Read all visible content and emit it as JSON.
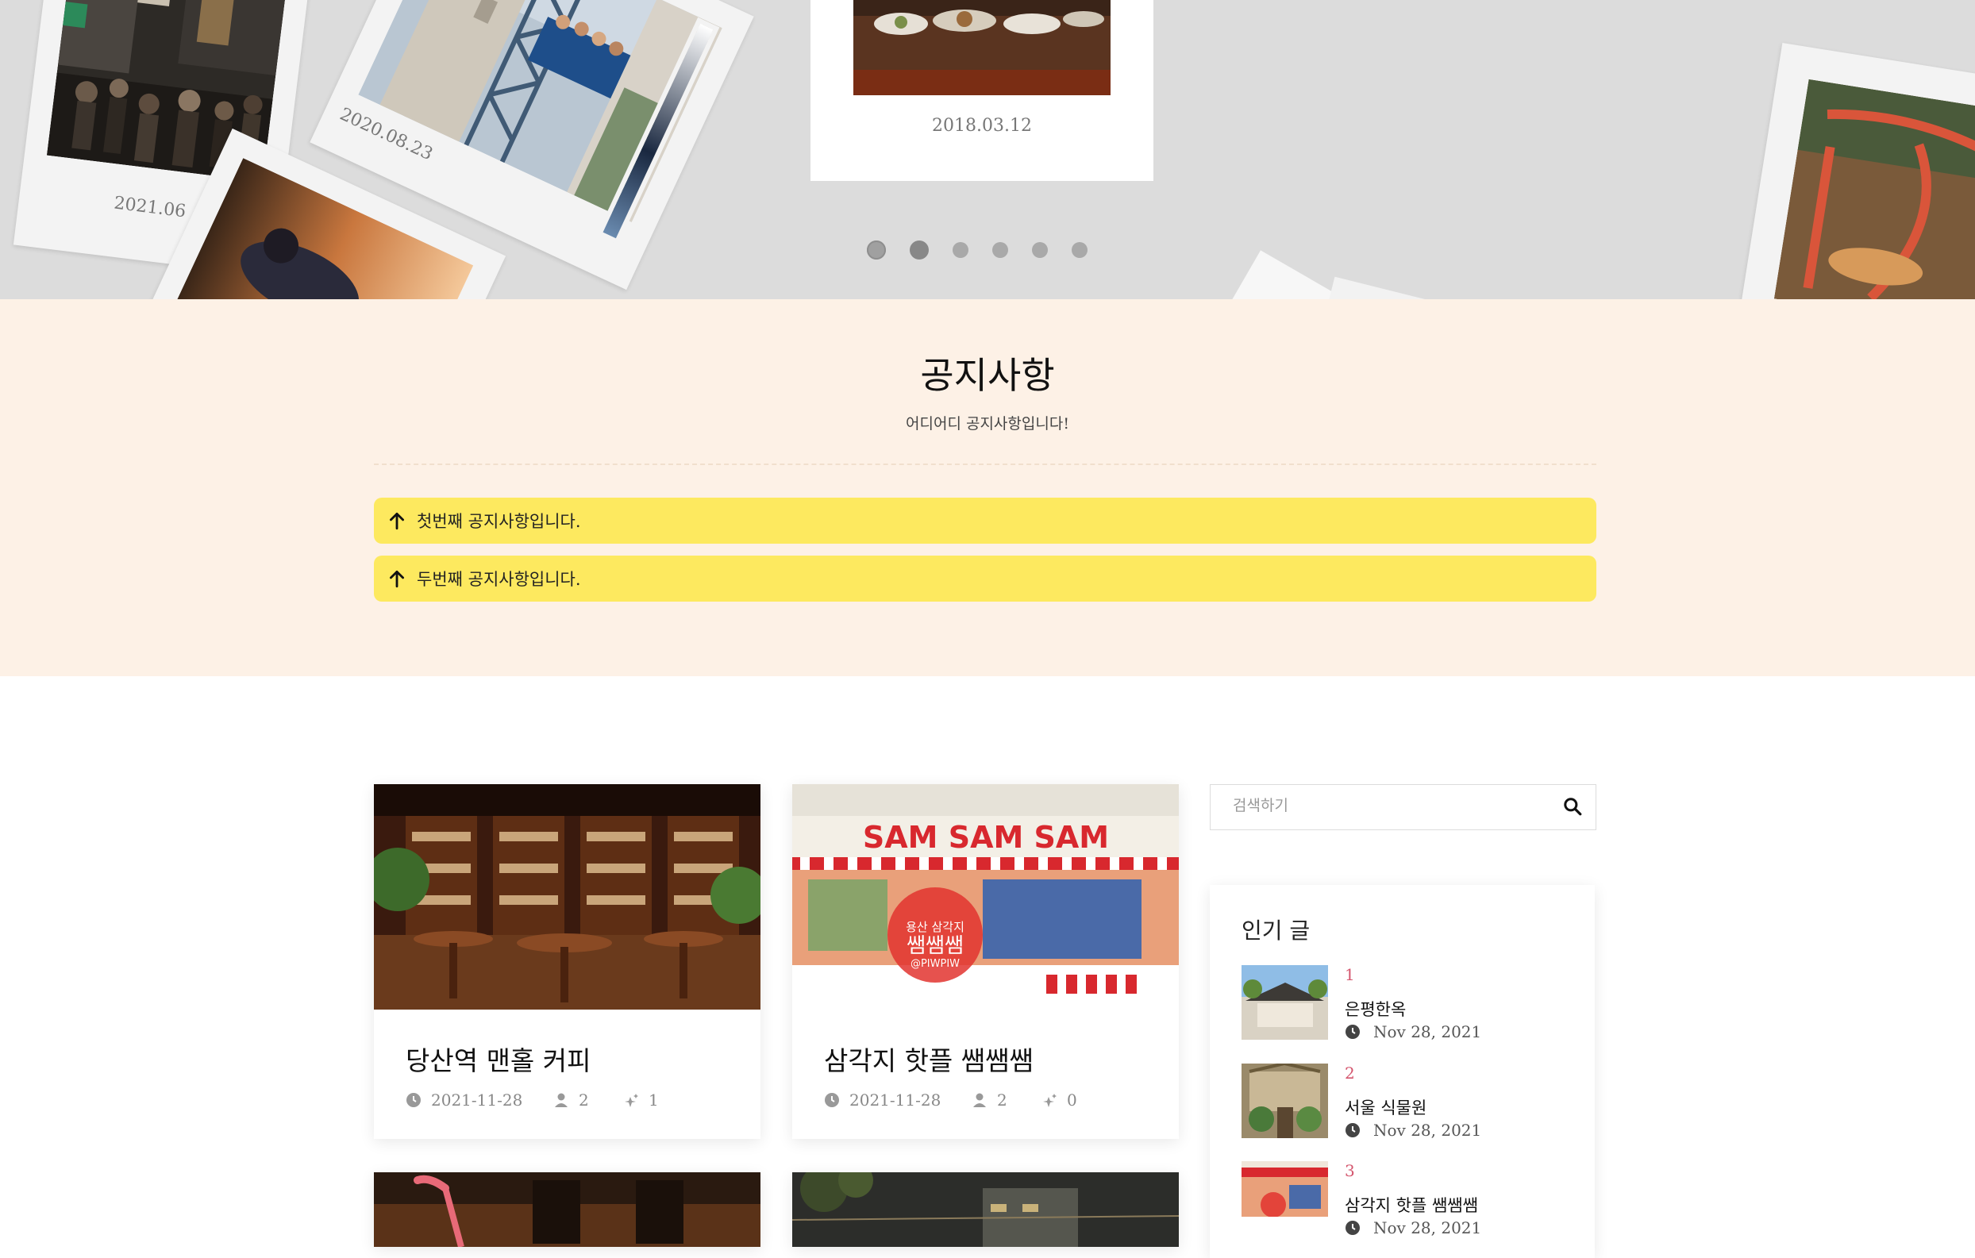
{
  "hero": {
    "captions": [
      "2021.06",
      "2020.08.23",
      "2018.03.12"
    ],
    "dots": [
      "slide-1",
      "slide-2",
      "slide-3",
      "slide-4",
      "slide-5",
      "slide-6"
    ],
    "active_dot": 2
  },
  "notice": {
    "title": "공지사항",
    "subtitle": "어디어디 공지사항입니다!",
    "items": [
      {
        "label": "첫번째 공지사항입니다."
      },
      {
        "label": "두번째 공지사항입니다."
      }
    ]
  },
  "posts": [
    {
      "title": "당산역 맨홀 커피",
      "date": "2021-11-28",
      "author_count": "2",
      "likes": "1"
    },
    {
      "title": "삼각지 핫플 쌤쌤쌤",
      "date": "2021-11-28",
      "author_count": "2",
      "likes": "0"
    }
  ],
  "sidebar": {
    "search": {
      "placeholder": "검색하기"
    },
    "popular": {
      "title": "인기 글",
      "items": [
        {
          "rank": "1",
          "title": "은평한옥",
          "date": "Nov 28, 2021"
        },
        {
          "rank": "2",
          "title": "서울 식물원",
          "date": "Nov 28, 2021"
        },
        {
          "rank": "3",
          "title": "삼각지 핫플 쌤쌤쌤",
          "date": "Nov 28, 2021"
        }
      ]
    }
  },
  "icons": {
    "arrow": "arrow-up-icon",
    "clock": "clock-icon",
    "user": "user-icon",
    "like": "sparkle-star-icon",
    "search": "search-icon"
  },
  "colors": {
    "hero_bg": "#dcdcdc",
    "notice_bg": "#fdf1e6",
    "notice_item": "#fde95f",
    "rank": "#d4556d"
  }
}
